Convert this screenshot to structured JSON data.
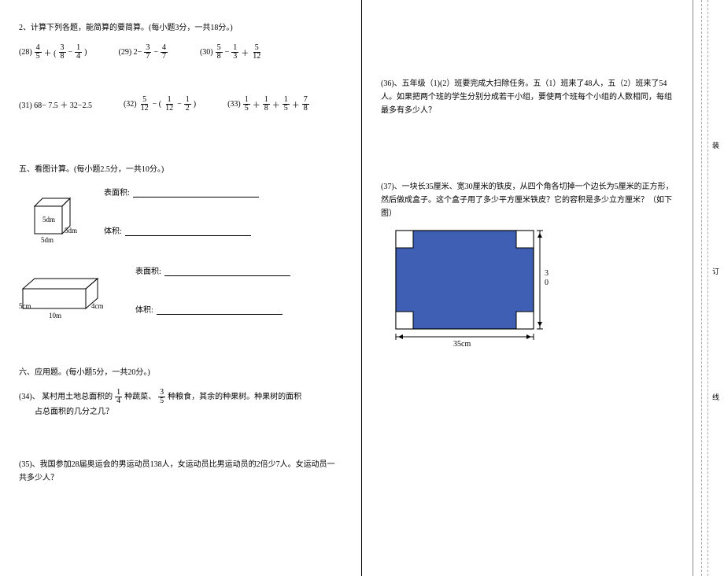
{
  "left": {
    "s2title": "2、计算下列各题，能简算的要简算。(每小题3分，一共18分。)",
    "p28": "(28)",
    "p29": "(29) 2−",
    "p30": "(30)",
    "p31": "(31) 68− 7.5 ＋ 32−2.5",
    "p32": "(32)",
    "p33": "(33)",
    "s5title": "五、看图计算。(每小题2.5分，一共10分。)",
    "surfaceLabel": "表面积:",
    "volumeLabel": "体积:",
    "cubeDim": "5dm",
    "prismH": "4cm",
    "prismL": "5cm",
    "prismW": "10m",
    "s6title": "六、应用题。(每小题5分，一共20分。)",
    "q34a": "(34)、 某村用土地总面积的",
    "q34b": "种蔬菜、",
    "q34c": "种粮食，其余的种果树。种果树的面积",
    "q34d": "占总面积的几分之几？",
    "q35": "(35)、我国参加28届奥运会的男运动员138人，女运动员比男运动员的2倍少7人。女运动员一共多少人？"
  },
  "right": {
    "q36": "(36)、五年级（1)(2）班要完成大扫除任务。五（1）班来了48人，五（2）班来了54人。如果把两个班的学生分别分成若干小组，要使两个班每个小组的人数相同，每组最多有多少人？",
    "q37": "(37)、一块长35厘米、宽30厘米的铁皮，从四个角各切掉一个边长为5厘米的正方形，然后做成盒子。这个盒子用了多少平方厘米铁皮？它的容积是多少立方厘米？（如下图）",
    "boxWidthLabel": "35cm",
    "boxHeightLabel": "30"
  },
  "fractions": {
    "f45": {
      "n": "4",
      "d": "5"
    },
    "f38": {
      "n": "3",
      "d": "8"
    },
    "f14": {
      "n": "1",
      "d": "4"
    },
    "f37": {
      "n": "3",
      "d": "7"
    },
    "f47": {
      "n": "4",
      "d": "7"
    },
    "f58": {
      "n": "5",
      "d": "8"
    },
    "f13": {
      "n": "1",
      "d": "3"
    },
    "f512": {
      "n": "5",
      "d": "12"
    },
    "f112": {
      "n": "1",
      "d": "12"
    },
    "f12": {
      "n": "1",
      "d": "2"
    },
    "f15": {
      "n": "1",
      "d": "5"
    },
    "f18": {
      "n": "1",
      "d": "8"
    },
    "f78": {
      "n": "7",
      "d": "8"
    },
    "f35": {
      "n": "3",
      "d": "5"
    }
  },
  "margin": {
    "l1": "装",
    "l2": "订",
    "l3": "线"
  }
}
